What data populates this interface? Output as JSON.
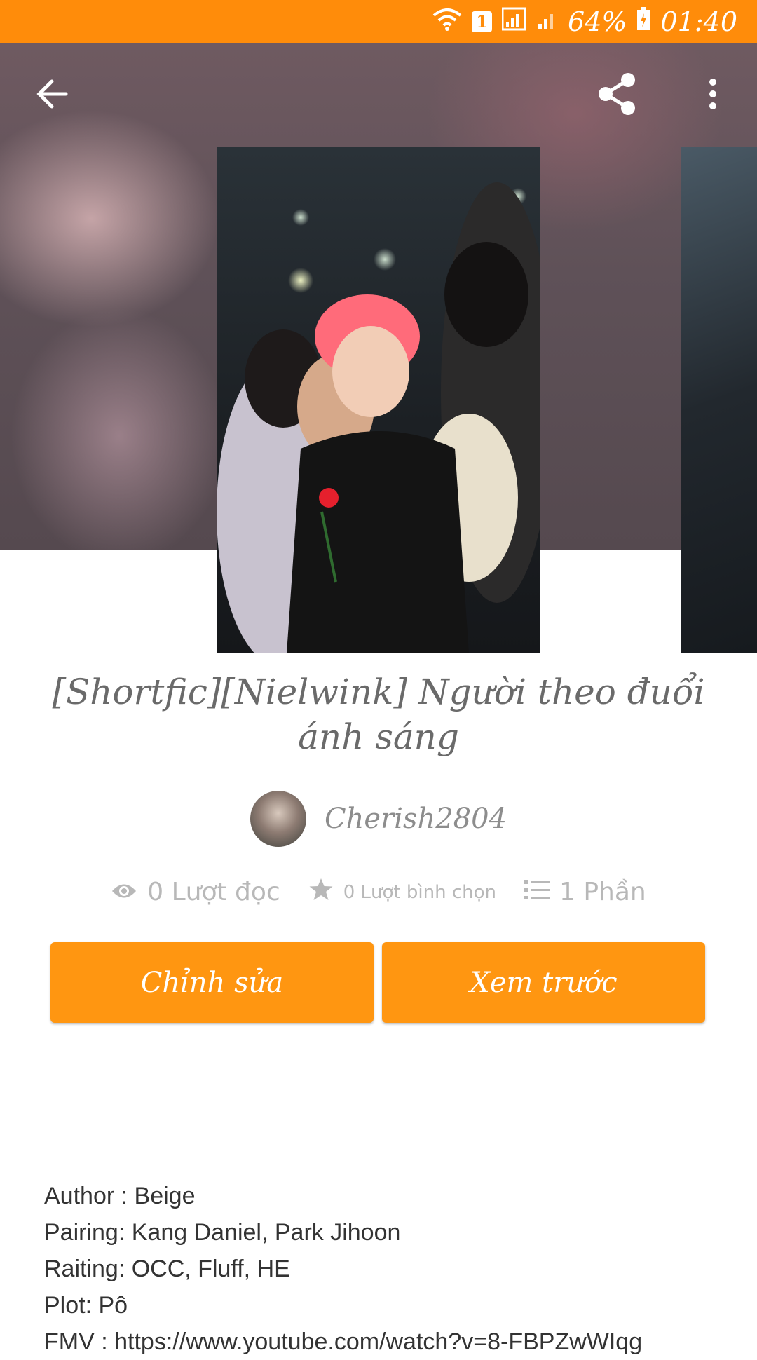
{
  "status_bar": {
    "sim_badge": "1",
    "battery": "64%",
    "time": "01:40"
  },
  "story": {
    "title": "[Shortfic][Nielwink] Người theo đuổi ánh sáng",
    "author": "Cherish2804"
  },
  "stats": {
    "reads": "0 Lượt đọc",
    "votes": "0 Lượt bình chọn",
    "parts": "1 Phần"
  },
  "actions": {
    "edit": "Chỉnh sửa",
    "preview": "Xem trước"
  },
  "description": [
    "Author : Beige",
    "Pairing: Kang Daniel, Park Jihoon",
    "Raiting: OCC, Fluff, HE",
    "Plot: Pô",
    "FMV : https://www.youtube.com/watch?v=8-FBPZwWIqg"
  ],
  "colors": {
    "accent": "#ff8c0a",
    "button": "#ff9611",
    "muted_text": "#b8b8b8"
  },
  "icons": {
    "back": "arrow-left-icon",
    "share": "share-icon",
    "more": "more-vertical-icon",
    "reads": "eye-icon",
    "votes": "star-icon",
    "parts": "list-icon"
  }
}
